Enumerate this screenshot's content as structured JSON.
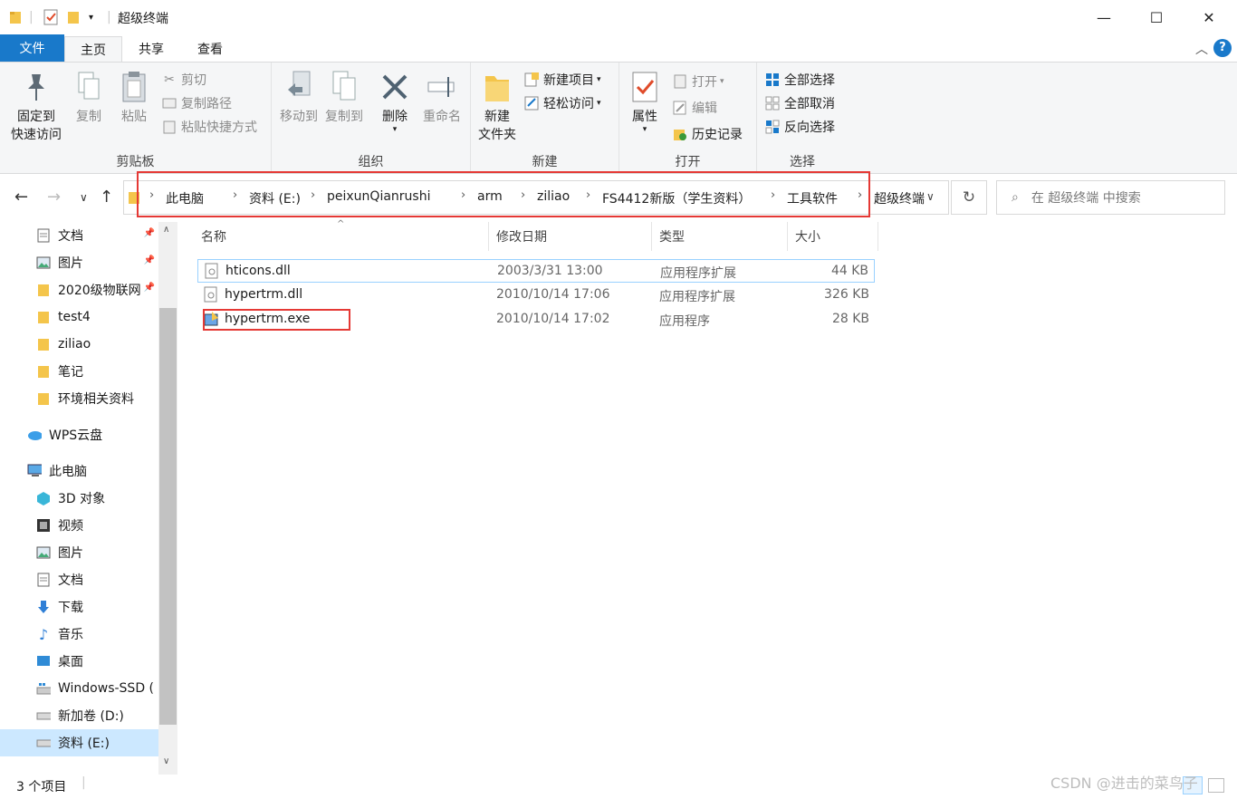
{
  "window": {
    "title": "超级终端",
    "minimize": "—",
    "maximize": "☐",
    "close": "✕"
  },
  "ribbon_tabs": {
    "file": "文件",
    "home": "主页",
    "share": "共享",
    "view": "查看"
  },
  "ribbon": {
    "clipboard": {
      "label": "剪贴板",
      "pin_line1": "固定到",
      "pin_line2": "快速访问",
      "copy": "复制",
      "paste": "粘贴",
      "cut": "剪切",
      "copy_path": "复制路径",
      "paste_shortcut": "粘贴快捷方式"
    },
    "organize": {
      "label": "组织",
      "move_to": "移动到",
      "copy_to": "复制到",
      "delete": "删除",
      "rename": "重命名"
    },
    "new": {
      "label": "新建",
      "new_folder_line1": "新建",
      "new_folder_line2": "文件夹",
      "new_item": "新建项目",
      "easy_access": "轻松访问"
    },
    "open": {
      "label": "打开",
      "properties": "属性",
      "open": "打开",
      "edit": "编辑",
      "history": "历史记录"
    },
    "select": {
      "label": "选择",
      "select_all": "全部选择",
      "select_none": "全部取消",
      "invert": "反向选择"
    }
  },
  "address": {
    "crumbs": [
      "此电脑",
      "资料 (E:)",
      "peixunQianrushi",
      "arm",
      "ziliao",
      "FS4412新版（学生资料）",
      "工具软件",
      "超级终端"
    ],
    "search_placeholder": "在 超级终端 中搜索"
  },
  "nav_pane": {
    "items": [
      {
        "label": "文档",
        "icon": "document-icon",
        "pinned": true
      },
      {
        "label": "图片",
        "icon": "picture-icon",
        "pinned": true
      },
      {
        "label": "2020级物联网",
        "icon": "folder-icon",
        "pinned": true
      },
      {
        "label": "test4",
        "icon": "folder-icon"
      },
      {
        "label": "ziliao",
        "icon": "folder-icon"
      },
      {
        "label": "笔记",
        "icon": "folder-icon"
      },
      {
        "label": "环境相关资料",
        "icon": "folder-icon"
      },
      {
        "label": "WPS云盘",
        "icon": "cloud-icon"
      },
      {
        "label": "此电脑",
        "icon": "computer-icon"
      },
      {
        "label": "3D 对象",
        "icon": "cube-icon"
      },
      {
        "label": "视频",
        "icon": "video-icon"
      },
      {
        "label": "图片",
        "icon": "picture-icon"
      },
      {
        "label": "文档",
        "icon": "document-icon"
      },
      {
        "label": "下载",
        "icon": "download-icon"
      },
      {
        "label": "音乐",
        "icon": "music-icon"
      },
      {
        "label": "桌面",
        "icon": "desktop-icon"
      },
      {
        "label": "Windows-SSD (",
        "icon": "windows-drive-icon"
      },
      {
        "label": "新加卷 (D:)",
        "icon": "drive-icon"
      },
      {
        "label": "资料 (E:)",
        "icon": "drive-icon",
        "selected": true
      }
    ]
  },
  "file_list": {
    "columns": {
      "name": "名称",
      "modified": "修改日期",
      "type": "类型",
      "size": "大小"
    },
    "rows": [
      {
        "name": "hticons.dll",
        "modified": "2003/3/31 13:00",
        "type": "应用程序扩展",
        "size": "44 KB",
        "icon": "dll-file-icon"
      },
      {
        "name": "hypertrm.dll",
        "modified": "2010/10/14 17:06",
        "type": "应用程序扩展",
        "size": "326 KB",
        "icon": "dll-file-icon"
      },
      {
        "name": "hypertrm.exe",
        "modified": "2010/10/14 17:02",
        "type": "应用程序",
        "size": "28 KB",
        "icon": "exe-file-icon"
      }
    ]
  },
  "status": {
    "count": "3 个项目"
  },
  "watermark": "CSDN @进击的菜鸟子",
  "colors": {
    "accent": "#1979ca",
    "highlight": "#e53935",
    "selection": "#cce8ff"
  }
}
